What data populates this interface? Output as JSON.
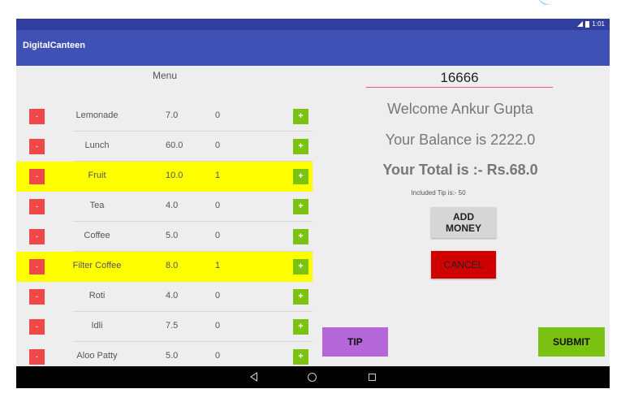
{
  "status": {
    "time": "1:01"
  },
  "app": {
    "title": "DigitalCanteen"
  },
  "menu": {
    "heading": "Menu",
    "minus_label": "-",
    "plus_label": "+",
    "items": [
      {
        "name": "Lemonade",
        "price": "7.0",
        "qty": "0",
        "highlighted": false
      },
      {
        "name": "Lunch",
        "price": "60.0",
        "qty": "0",
        "highlighted": false
      },
      {
        "name": "Fruit",
        "price": "10.0",
        "qty": "1",
        "highlighted": true
      },
      {
        "name": "Tea",
        "price": "4.0",
        "qty": "0",
        "highlighted": false
      },
      {
        "name": "Coffee",
        "price": "5.0",
        "qty": "0",
        "highlighted": false
      },
      {
        "name": "Filter Coffee",
        "price": "8.0",
        "qty": "1",
        "highlighted": true
      },
      {
        "name": "Roti",
        "price": "4.0",
        "qty": "0",
        "highlighted": false
      },
      {
        "name": "Idli",
        "price": "7.5",
        "qty": "0",
        "highlighted": false
      },
      {
        "name": "Aloo Patty",
        "price": "5.0",
        "qty": "0",
        "highlighted": false
      }
    ]
  },
  "account": {
    "id_value": "16666",
    "welcome": "Welcome Ankur Gupta",
    "balance": "Your Balance is 2222.0",
    "total": "Your Total is :- Rs.68.0",
    "included_tip": "Included Tip is:- 50"
  },
  "buttons": {
    "add_money_line1": "ADD",
    "add_money_line2": "MONEY",
    "cancel": "CANCEL",
    "tip": "TIP",
    "submit": "SUBMIT"
  },
  "colors": {
    "app_bar": "#3f51b5",
    "status_bar": "#303f9f",
    "highlight": "#ffff00",
    "minus": "#f04848",
    "plus": "#7cc213",
    "cancel": "#d10000",
    "tip": "#b566d8",
    "submit": "#7cc213"
  },
  "icons": {
    "signal": "signal-icon",
    "battery": "battery-icon",
    "nav_back": "back-triangle-icon",
    "nav_home": "home-circle-icon",
    "nav_recents": "recents-square-icon"
  }
}
